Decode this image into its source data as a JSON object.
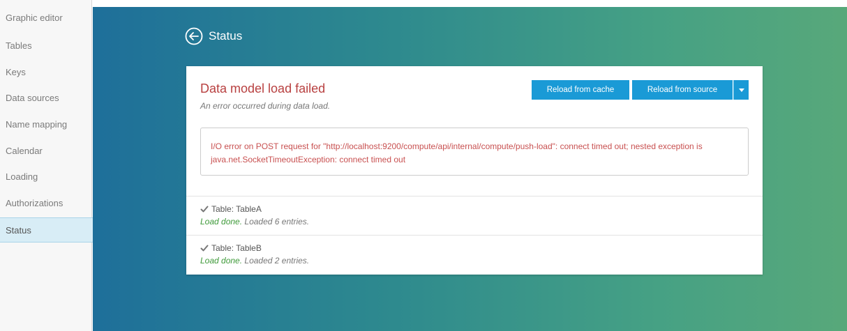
{
  "sidebar": {
    "items": [
      {
        "label": "Graphic editor"
      },
      {
        "label": "Tables"
      },
      {
        "label": "Keys"
      },
      {
        "label": "Data sources"
      },
      {
        "label": "Name mapping"
      },
      {
        "label": "Calendar"
      },
      {
        "label": "Loading"
      },
      {
        "label": "Authorizations"
      },
      {
        "label": "Status",
        "active": true
      }
    ]
  },
  "header": {
    "back_icon": "back-circle-arrow-icon",
    "title": "Status"
  },
  "card": {
    "error_title": "Data model load failed",
    "error_subtitle": "An error occurred during data load.",
    "buttons": {
      "reload_cache": "Reload from cache",
      "reload_source": "Reload from source",
      "dropdown_icon": "caret-down-icon"
    },
    "error_message": "I/O error on POST request for \"http://localhost:9200/compute/api/internal/compute/push-load\": connect timed out; nested exception is java.net.SocketTimeoutException: connect timed out",
    "tables": [
      {
        "name": "Table: TableA",
        "status": "Load done.",
        "detail": "Loaded 6 entries."
      },
      {
        "name": "Table: TableB",
        "status": "Load done.",
        "detail": "Loaded 2 entries."
      }
    ]
  },
  "colors": {
    "accent_button": "#1a9ad6",
    "error_text": "#b84040",
    "success_text": "#3f9a3a",
    "active_nav_bg": "#d8edf6"
  }
}
